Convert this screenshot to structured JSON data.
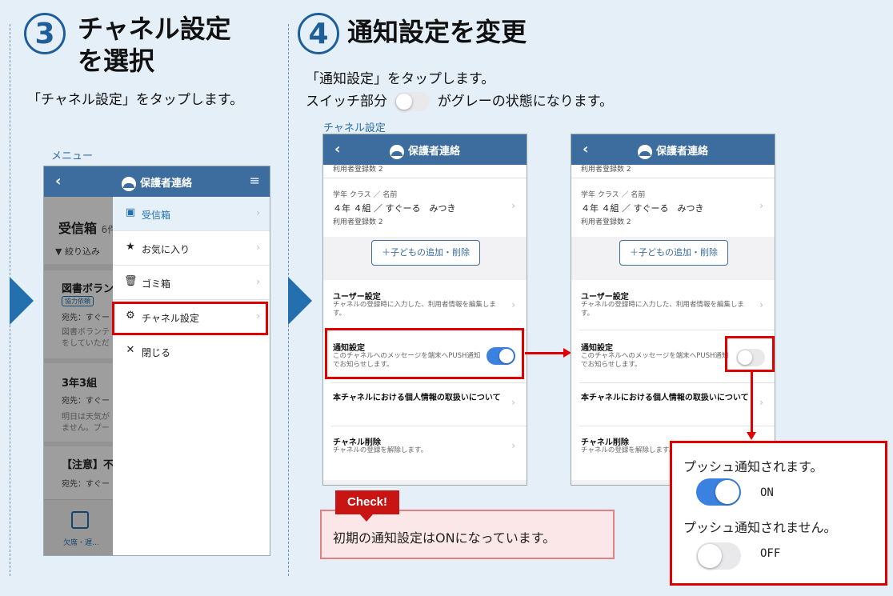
{
  "step3": {
    "number": "3",
    "title_line1": "チャネル設定",
    "title_line2": "を選択",
    "desc": "「チャネル設定」をタップします。",
    "caption": "メニュー"
  },
  "step4": {
    "number": "4",
    "title": "通知設定を変更",
    "desc1": "「通知設定」をタップします。",
    "desc2_pre": "スイッチ部分",
    "desc2_post": "がグレーの状態になります。",
    "caption": "チャネル設定"
  },
  "menu_screen": {
    "app_title": "保護者連絡",
    "bg_heading": "受信箱",
    "bg_count": "6件",
    "bg_filter": "絞り込み",
    "bg_item1_title": "図書ボラン",
    "bg_item1_badge": "協力依頼",
    "bg_item1_to": "宛先：すぐー",
    "bg_item1_body1": "図書ボランテ",
    "bg_item1_body2": "をしていただ",
    "bg_item2_title": "3年3組",
    "bg_item2_to": "宛先：すぐー",
    "bg_item2_body1": "明日は天気が",
    "bg_item2_body2": "ません。プー",
    "bg_item3_title": "【注意】不",
    "bg_item3_to": "宛先：すぐー",
    "bg_tab_label": "欠席・遅…",
    "items": [
      {
        "label": "受信箱"
      },
      {
        "label": "お気に入り"
      },
      {
        "label": "ゴミ箱"
      },
      {
        "label": "チャネル設定"
      },
      {
        "label": "閉じる"
      }
    ]
  },
  "channel_screen": {
    "app_title": "保護者連絡",
    "cut_top": "利用者登録数 2",
    "class_label": "学年 クラス ／ 名前",
    "class_value": "４年 ４組 ／ すぐーる　みつき",
    "user_count": "利用者登録数 2",
    "add_button": "＋子どもの追加・削除",
    "user_settings_title": "ユーザー設定",
    "user_settings_sub": "チャネルの登録時に入力した、利用者情報を編集します。",
    "notif_title": "通知設定",
    "notif_sub": "このチャネルへのメッセージを端末へPUSH通知でお知らせします。",
    "privacy_title": "本チャネルにおける個人情報の取扱いについて",
    "delete_title": "チャネル削除",
    "delete_sub": "チャネルの登録を解除します。"
  },
  "check_note": {
    "badge": "Check!",
    "text": "初期の通知設定はONになっています。"
  },
  "legend": {
    "on_text": "プッシュ通知されます。",
    "on_label": "ON",
    "off_text": "プッシュ通知されません。",
    "off_label": "OFF"
  },
  "colors": {
    "accent_blue": "#2470ae",
    "nav_blue": "#3c6d9e",
    "toggle_on": "#3b82e0",
    "highlight_red": "#e00000"
  }
}
